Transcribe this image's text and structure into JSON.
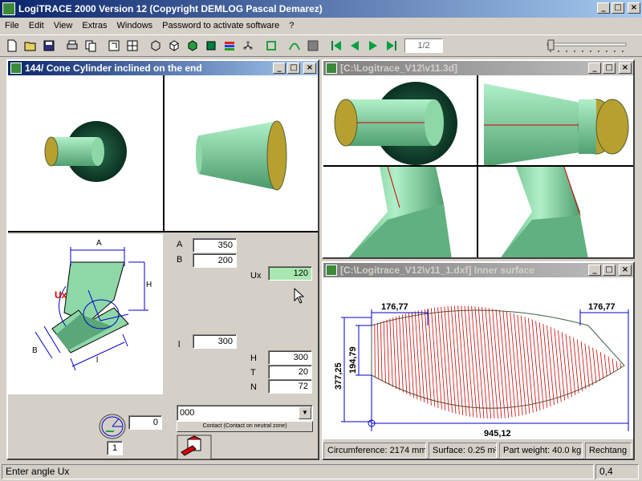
{
  "app": {
    "title": "LogiTRACE 2000  Version 12  (Copyright DEMLOG Pascal Demarez)"
  },
  "window_buttons": {
    "minimize": "_",
    "maximize": "□",
    "close": "×"
  },
  "menu": [
    "File",
    "Edit",
    "View",
    "Extras",
    "Windows",
    "Password to activate software",
    "?"
  ],
  "toolbar": {
    "page_indicator": "1/2"
  },
  "window_main": {
    "title": "144/ Cone Cylinder inclined on the end"
  },
  "window_3d": {
    "title": "[C:\\Logitrace_V12\\v11.3d]"
  },
  "window_dxf": {
    "title": "[C:\\Logitrace_V12\\v11_1.dxf]  Inner surface"
  },
  "diagram": {
    "A": "A",
    "H": "H",
    "Ux": "Ux",
    "B": "B",
    "l": "l"
  },
  "params": {
    "A_label": "A",
    "A_value": "350",
    "B_label": "B",
    "B_value": "200",
    "Ux_label": "Ux",
    "Ux_value": "120",
    "l_label": "l",
    "l_value": "300",
    "H_label": "H",
    "H_value": "300",
    "T_label": "T",
    "T_value": "20",
    "N_label": "N",
    "N_value": "72"
  },
  "angle_value": "0",
  "angle_counter": "1",
  "combo": {
    "value": "000"
  },
  "contact_button": "Contact (Contact on neutral zone)",
  "pattern": {
    "dim_top_left": "176,77",
    "dim_top_right": "176,77",
    "dim_left_inner": "194,79",
    "dim_left_outer": "377,25",
    "dim_bottom": "945,12"
  },
  "dxf_status": {
    "circumference": "Circumference: 2174 mm",
    "surface": "Surface: 0.25 m²",
    "weight": "Part weight: 40.0 kg",
    "shape": "Rechtang"
  },
  "statusbar": {
    "message": "Enter angle Ux",
    "value": "0,4"
  },
  "colors": {
    "title_active": "#0a246a",
    "pipe_green": "#8ed8a8",
    "pipe_inner": "#b8a030",
    "red_lines": "#cc0000",
    "blue_dims": "#0000cc"
  }
}
